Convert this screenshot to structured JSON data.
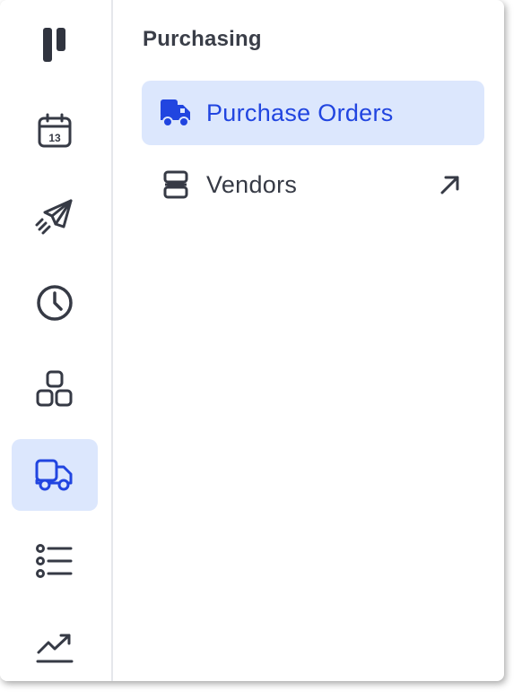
{
  "sidebar": {
    "items": [
      {
        "name": "calendar",
        "icon": "calendar-icon",
        "badge": "13",
        "active": false
      },
      {
        "name": "launch",
        "icon": "rocket-icon",
        "active": false
      },
      {
        "name": "time",
        "icon": "clock-icon",
        "active": false
      },
      {
        "name": "modules",
        "icon": "apps-icon",
        "active": false
      },
      {
        "name": "purchasing",
        "icon": "truck-icon",
        "active": true
      },
      {
        "name": "lists",
        "icon": "list-icon",
        "active": false
      },
      {
        "name": "reports",
        "icon": "trend-icon",
        "active": false
      }
    ]
  },
  "panel": {
    "title": "Purchasing",
    "items": [
      {
        "label": "Purchase Orders",
        "icon": "truck-icon",
        "active": true
      },
      {
        "label": "Vendors",
        "icon": "store-icon",
        "active": false,
        "external": true
      }
    ]
  },
  "colors": {
    "accent": "#2145e0",
    "active_bg": "#dce7fd",
    "icon": "#363a45",
    "divider": "#e5e7eb"
  }
}
